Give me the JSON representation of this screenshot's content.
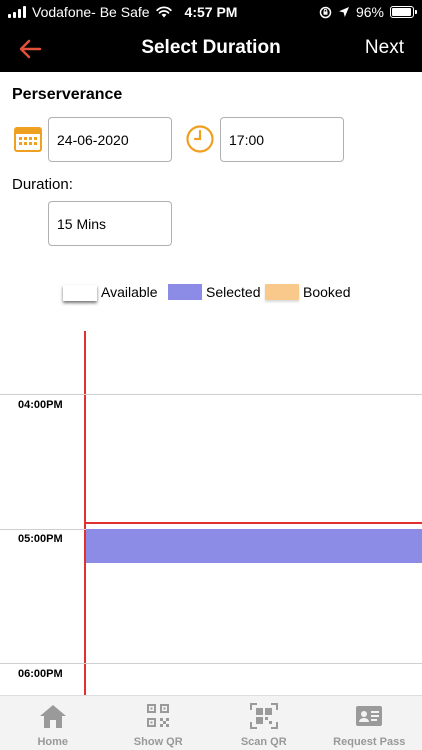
{
  "status_bar": {
    "carrier": "Vodafone- Be Safe",
    "time": "4:57 PM",
    "battery": "96%",
    "battery_level": 0.96
  },
  "nav": {
    "title": "Select Duration",
    "next_label": "Next",
    "back_icon": "back-arrow-icon",
    "accent_color": "#e0503a"
  },
  "form": {
    "section_title": "Perserverance",
    "date_value": "24-06-2020",
    "time_value": "17:00",
    "duration_label": "Duration:",
    "duration_value": "15 Mins",
    "icon_color": "#f0a020"
  },
  "legend": [
    {
      "label": "Available",
      "color": "#ffffff"
    },
    {
      "label": "Selected",
      "color": "#8c8ce6"
    },
    {
      "label": "Booked",
      "color": "#f9c98b"
    }
  ],
  "timeline": {
    "hours": [
      "04:00PM",
      "05:00PM",
      "06:00PM"
    ],
    "line_color": "#e03030"
  },
  "tabs": [
    {
      "label": "Home",
      "icon": "home-icon"
    },
    {
      "label": "Show QR",
      "icon": "qr-code-icon"
    },
    {
      "label": "Scan QR",
      "icon": "scan-qr-icon"
    },
    {
      "label": "Request Pass",
      "icon": "id-card-icon"
    }
  ]
}
